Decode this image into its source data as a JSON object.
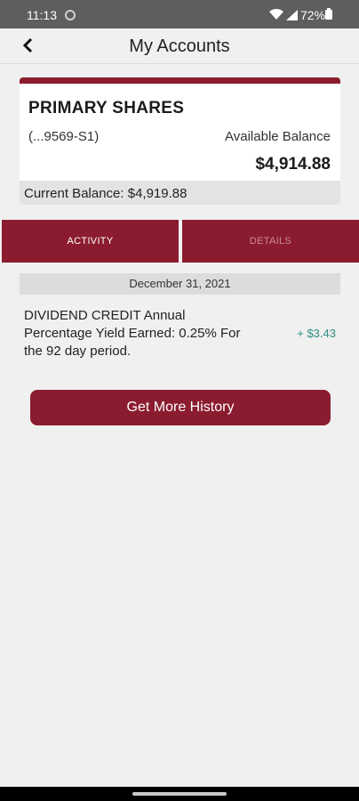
{
  "status_bar": {
    "time": "11:13",
    "battery": "72%"
  },
  "header": {
    "title": "My Accounts"
  },
  "account": {
    "name": "PRIMARY SHARES",
    "number": "(...9569-S1)",
    "available_label": "Available Balance",
    "available_amount": "$4,914.88",
    "current_balance": "Current Balance: $4,919.88",
    "accent_color": "#8b1c2f"
  },
  "tabs": [
    {
      "label": "ACTIVITY",
      "selected": true
    },
    {
      "label": "DETAILS",
      "selected": false
    }
  ],
  "activity": {
    "date": "December 31, 2021",
    "transactions": [
      {
        "description": "DIVIDEND CREDIT Annual Percentage Yield Earned: 0.25% For the 92 day period.",
        "amount": "+ $3.43",
        "amount_color": "#2e8f86"
      }
    ]
  },
  "buttons": {
    "more_history": "Get More History"
  }
}
